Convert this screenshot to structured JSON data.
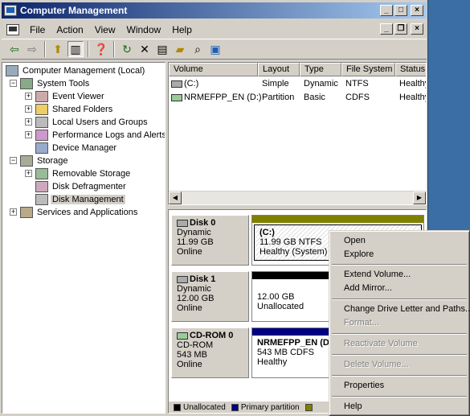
{
  "window": {
    "title": "Computer Management"
  },
  "menubar": {
    "items": [
      "File",
      "Action",
      "View",
      "Window",
      "Help"
    ]
  },
  "toolbar": {
    "icons": [
      "back-arrow-icon",
      "forward-arrow-icon",
      "up-folder-icon",
      "show-tree-icon",
      "properties-icon",
      "refresh-icon",
      "delete-icon",
      "properties-page-icon",
      "open-folder-icon",
      "search-icon",
      "help-icon"
    ]
  },
  "tree": {
    "root": "Computer Management (Local)",
    "system_tools": "System Tools",
    "event_viewer": "Event Viewer",
    "shared_folders": "Shared Folders",
    "local_users": "Local Users and Groups",
    "perf_logs": "Performance Logs and Alerts",
    "device_manager": "Device Manager",
    "storage": "Storage",
    "removable_storage": "Removable Storage",
    "disk_defrag": "Disk Defragmenter",
    "disk_management": "Disk Management",
    "services": "Services and Applications"
  },
  "volume_list": {
    "headers": [
      "Volume",
      "Layout",
      "Type",
      "File System",
      "Status"
    ],
    "rows": [
      {
        "volume": "(C:)",
        "layout": "Simple",
        "type": "Dynamic",
        "fs": "NTFS",
        "status": "Healthy"
      },
      {
        "volume": "NRMEFPP_EN (D:)",
        "layout": "Partition",
        "type": "Basic",
        "fs": "CDFS",
        "status": "Healthy"
      }
    ]
  },
  "disks": [
    {
      "name": "Disk 0",
      "type": "Dynamic",
      "size": "11.99 GB",
      "state": "Online",
      "vol_name": "(C:)",
      "vol_size": "11.99 GB NTFS",
      "vol_status": "Healthy (System)",
      "bar_color": "#808000"
    },
    {
      "name": "Disk 1",
      "type": "Dynamic",
      "size": "12.00 GB",
      "state": "Online",
      "vol_name": "",
      "vol_size": "12.00 GB",
      "vol_status": "Unallocated",
      "bar_color": "#000000"
    },
    {
      "name": "CD-ROM 0",
      "type": "CD-ROM",
      "size": "543 MB",
      "state": "Online",
      "vol_name": "NRMEFPP_EN (D",
      "vol_size": "543 MB CDFS",
      "vol_status": "Healthy",
      "bar_color": "#000080"
    }
  ],
  "legend": {
    "unallocated": "Unallocated",
    "primary": "Primary partition",
    "colors": {
      "unallocated": "#000000",
      "primary": "#000080",
      "other": "#808000"
    }
  },
  "context_menu": {
    "open": "Open",
    "explore": "Explore",
    "extend": "Extend Volume...",
    "add_mirror": "Add Mirror...",
    "change_letter": "Change Drive Letter and Paths...",
    "format": "Format...",
    "reactivate": "Reactivate Volume",
    "delete": "Delete Volume...",
    "properties": "Properties",
    "help": "Help"
  }
}
